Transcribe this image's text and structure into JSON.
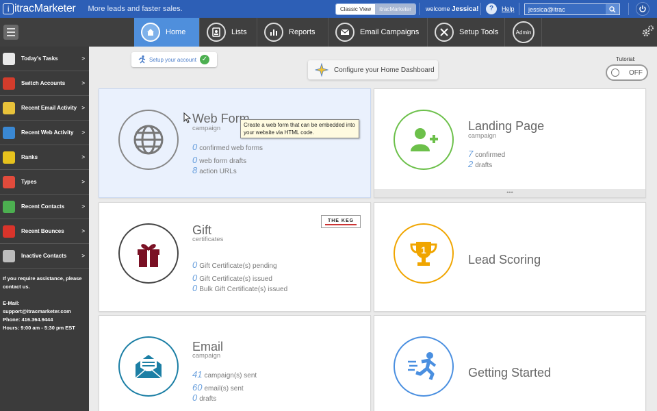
{
  "topbar": {
    "brand": "itracMarketer",
    "tagline": "More leads and faster sales.",
    "view_classic": "Classic View",
    "view_itrac": "itracMarketer",
    "welcome_prefix": "welcome",
    "welcome_user": "Jessica!",
    "help": "Help",
    "search_value": "jessica@itrac"
  },
  "nav": {
    "items": [
      {
        "label": "Home",
        "icon": "home-icon"
      },
      {
        "label": "Lists",
        "icon": "contacts-book-icon"
      },
      {
        "label": "Reports",
        "icon": "bar-chart-icon"
      },
      {
        "label": "Email Campaigns",
        "icon": "envelope-icon"
      },
      {
        "label": "Setup Tools",
        "icon": "tools-icon"
      }
    ],
    "admin": "Admin"
  },
  "sidebar": {
    "items": [
      {
        "label": "Today's Tasks",
        "icon": "clipboard-icon",
        "color": "#e8e8e8"
      },
      {
        "label": "Switch Accounts",
        "icon": "switch-icon",
        "color": "#d33c2c"
      },
      {
        "label": "Recent Email Activity",
        "icon": "email-icon",
        "color": "#e8c23a"
      },
      {
        "label": "Recent Web Activity",
        "icon": "globe-icon",
        "color": "#3a88d3"
      },
      {
        "label": "Ranks",
        "icon": "ranks-icon",
        "color": "#e6c21d"
      },
      {
        "label": "Types",
        "icon": "types-icon",
        "color": "#e24b3c"
      },
      {
        "label": "Recent Contacts",
        "icon": "contacts-icon",
        "color": "#4caf50"
      },
      {
        "label": "Recent Bounces",
        "icon": "pin-icon",
        "color": "#d9342b"
      },
      {
        "label": "Inactive Contacts",
        "icon": "inactive-icon",
        "color": "#bdbdbd"
      }
    ],
    "assist_text": "If you require assistance, please contact us.",
    "email_label": "E-Mail:",
    "email": "support@itracmarketer.com",
    "phone": "Phone: 416.364.9444",
    "hours": "Hours: 9:00 am - 5:30 pm EST"
  },
  "main": {
    "setup_account": "Setup your account",
    "configure_dashboard": "Configure your Home Dashboard",
    "tutorial_label": "Tutorial:",
    "tutorial_state": "OFF",
    "tooltip": "Create a web form that can be embedded into your website via HTML code.",
    "keg_text": "THE KEG",
    "cards": {
      "webform": {
        "title": "Web Form",
        "subtitle": "campaign",
        "stats": [
          {
            "num": "0",
            "label": "confirmed web forms"
          },
          {
            "num": "0",
            "label": "web form drafts"
          },
          {
            "num": "8",
            "label": "action URLs"
          }
        ]
      },
      "landing": {
        "title": "Landing Page",
        "subtitle": "campaign",
        "stats": [
          {
            "num": "7",
            "label": "confirmed"
          },
          {
            "num": "2",
            "label": "drafts"
          }
        ],
        "more": "•••"
      },
      "gift": {
        "title": "Gift",
        "subtitle": "certificates",
        "stats": [
          {
            "num": "0",
            "label": "Gift Certificate(s) pending"
          },
          {
            "num": "0",
            "label": "Gift Certificate(s) issued"
          },
          {
            "num": "0",
            "label": "Bulk Gift Certificate(s) issued"
          }
        ]
      },
      "leadscoring": {
        "title": "Lead Scoring"
      },
      "email": {
        "title": "Email",
        "subtitle": "campaign",
        "stats": [
          {
            "num": "41",
            "label": "campaign(s) sent"
          },
          {
            "num": "60",
            "label": "email(s) sent"
          },
          {
            "num": "0",
            "label": "drafts"
          }
        ]
      },
      "getstarted": {
        "title": "Getting Started"
      }
    }
  },
  "colors": {
    "topbar": "#2d5fb6",
    "nav_active": "#4f8fdc",
    "landing_green": "#6cc04a",
    "lead_orange": "#f0a500",
    "email_teal": "#1c7fa5",
    "gift_maroon": "#7a1024",
    "getstarted_blue": "#4a8fe0"
  }
}
